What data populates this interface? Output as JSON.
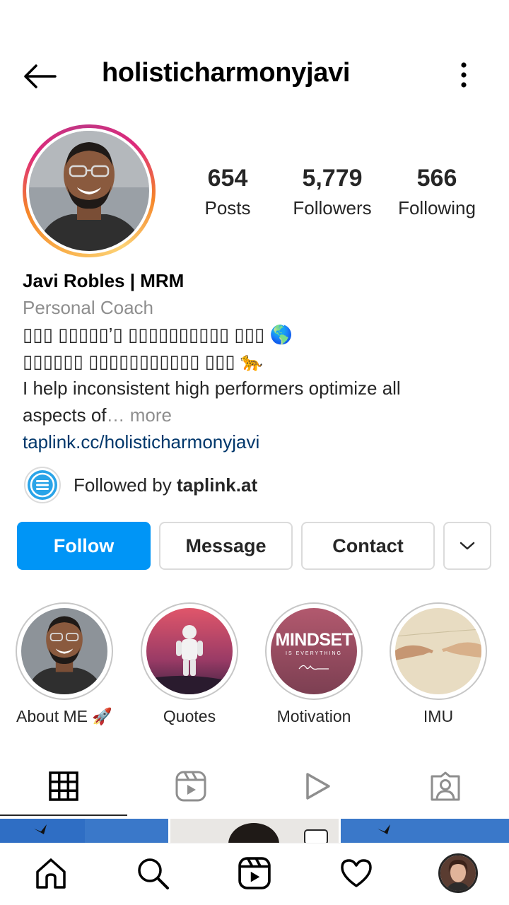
{
  "header": {
    "username": "holisticharmonyjavi",
    "back_icon": "arrow-left-icon",
    "menu_icon": "more-vertical-icon"
  },
  "stats": {
    "posts": {
      "value": "654",
      "label": "Posts"
    },
    "followers": {
      "value": "5,779",
      "label": "Followers"
    },
    "following": {
      "value": "566",
      "label": "Following"
    }
  },
  "bio": {
    "name": "Javi Robles | MRM",
    "category": "Personal Coach",
    "line1": "▯▯▯ ▯▯▯▯▯’▯ ▯▯▯▯▯▯▯▯▯▯ ▯▯▯",
    "line1_emoji": "🌎",
    "line2": "▯▯▯▯▯▯ ▯▯▯▯▯▯▯▯▯▯▯ ▯▯▯",
    "line2_emoji": "🐆",
    "line3": "I help inconsistent high performers optimize all",
    "line4": "aspects of",
    "more": "… more",
    "link": "taplink.cc/holisticharmonyjavi"
  },
  "followed_by": {
    "prefix": "Followed by ",
    "account": "taplink.at"
  },
  "actions": {
    "follow": "Follow",
    "message": "Message",
    "contact": "Contact"
  },
  "highlights": [
    {
      "label": "About ME 🚀"
    },
    {
      "label": "Quotes"
    },
    {
      "label": "Motivation",
      "title": "MINDSET",
      "subtitle": "IS EVERYTHING"
    },
    {
      "label": "IMU"
    }
  ],
  "colors": {
    "follow_blue": "#0095f6",
    "link_blue": "#00376b",
    "secondary_text": "#8e8e8e",
    "border": "#dbdbdb"
  }
}
